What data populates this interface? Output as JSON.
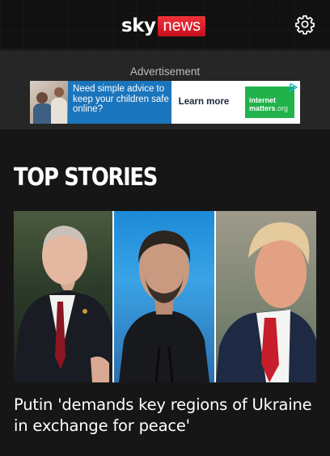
{
  "header": {
    "logo_sky": "sky",
    "logo_news": "news",
    "settings_icon": "gear-icon",
    "brand_red": "#e8232e",
    "background": "#111111"
  },
  "advertisement": {
    "label": "Advertisement",
    "banner_text": "Need simple advice to keep your children safe online?",
    "cta_label": "Learn more",
    "sponsor_line1": "internet",
    "sponsor_line2": "matters",
    "sponsor_suffix": ".org",
    "banner_color": "#1b75bc",
    "sponsor_color": "#21b24b"
  },
  "main": {
    "section_title": "TOP STORIES",
    "top_story": {
      "headline": "Putin 'demands key regions of Ukraine in exchange for peace'"
    }
  }
}
